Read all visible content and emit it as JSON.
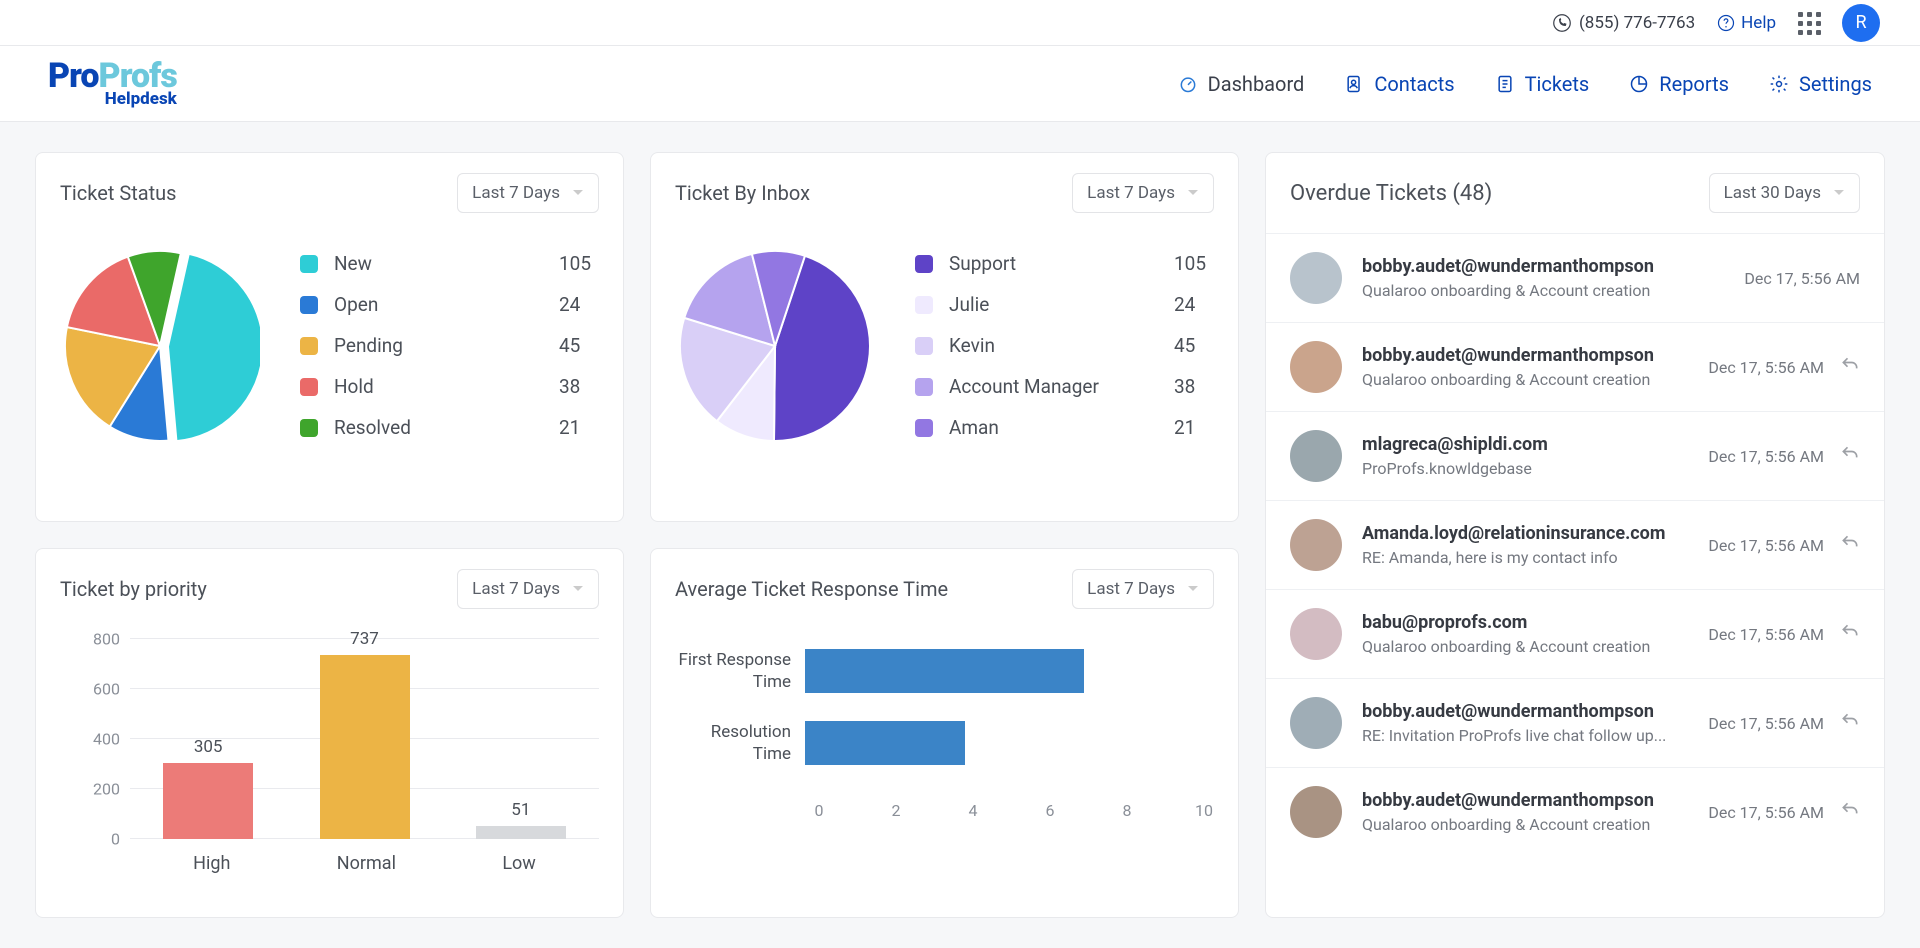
{
  "topbar": {
    "phone": "(855) 776-7763",
    "help": "Help",
    "avatar_letter": "R"
  },
  "brand": {
    "pro": "Pro",
    "profs": "Profs",
    "sub": "Helpdesk"
  },
  "nav": [
    {
      "label": "Dashbaord",
      "active": true
    },
    {
      "label": "Contacts",
      "active": false
    },
    {
      "label": "Tickets",
      "active": false
    },
    {
      "label": "Reports",
      "active": false
    },
    {
      "label": "Settings",
      "active": false
    }
  ],
  "cards": {
    "status": {
      "title": "Ticket Status",
      "range": "Last 7 Days"
    },
    "inbox": {
      "title": "Ticket By Inbox",
      "range": "Last 7 Days"
    },
    "priority": {
      "title": "Ticket by priority",
      "range": "Last 7 Days"
    },
    "response": {
      "title": "Average Ticket Response Time",
      "range": "Last 7 Days"
    }
  },
  "overdue": {
    "title": "Overdue Tickets (48)",
    "range": "Last 30 Days"
  },
  "tickets": [
    {
      "from": "bobby.audet@wundermanthompson",
      "subject": "Qualaroo onboarding & Account creation",
      "time": "Dec 17, 5:56 AM",
      "reply": false
    },
    {
      "from": "bobby.audet@wundermanthompson",
      "subject": "Qualaroo onboarding & Account creation",
      "time": "Dec 17, 5:56 AM",
      "reply": true
    },
    {
      "from": "mlagreca@shipldi.com",
      "subject": "ProProfs.knowldgebase",
      "time": "Dec 17, 5:56 AM",
      "reply": true
    },
    {
      "from": "Amanda.loyd@relationinsurance.com",
      "subject": "RE: Amanda, here is my contact info",
      "time": "Dec 17, 5:56 AM",
      "reply": true
    },
    {
      "from": "babu@proprofs.com",
      "subject": "Qualaroo onboarding & Account creation",
      "time": "Dec 17, 5:56 AM",
      "reply": true
    },
    {
      "from": "bobby.audet@wundermanthompson",
      "subject": "RE: Invitation ProProfs live chat follow up...",
      "time": "Dec 17, 5:56 AM",
      "reply": true
    },
    {
      "from": "bobby.audet@wundermanthompson",
      "subject": "Qualaroo onboarding & Account creation",
      "time": "Dec 17, 5:56 AM",
      "reply": true
    }
  ],
  "chart_data": [
    {
      "id": "status",
      "type": "pie",
      "title": "Ticket Status",
      "series": [
        {
          "name": "New",
          "value": 105,
          "color": "#2ecdd6"
        },
        {
          "name": "Open",
          "value": 24,
          "color": "#2a7ad6"
        },
        {
          "name": "Pending",
          "value": 45,
          "color": "#ecb445"
        },
        {
          "name": "Hold",
          "value": 38,
          "color": "#ea6a68"
        },
        {
          "name": "Resolved",
          "value": 21,
          "color": "#3fa52c"
        }
      ]
    },
    {
      "id": "inbox",
      "type": "pie",
      "title": "Ticket By Inbox",
      "series": [
        {
          "name": "Support",
          "value": 105,
          "color": "#5e43c7"
        },
        {
          "name": "Julie",
          "value": 24,
          "color": "#efeafe"
        },
        {
          "name": "Kevin",
          "value": 45,
          "color": "#d9cff7"
        },
        {
          "name": "Account Manager",
          "value": 38,
          "color": "#b5a3ee"
        },
        {
          "name": "Aman",
          "value": 21,
          "color": "#9277e2"
        }
      ]
    },
    {
      "id": "priority",
      "type": "bar",
      "title": "Ticket by priority",
      "categories": [
        "High",
        "Normal",
        "Low"
      ],
      "values": [
        305,
        737,
        51
      ],
      "colors": [
        "#ec7b78",
        "#ecb445",
        "#d7d9dc"
      ],
      "yticks": [
        0,
        200,
        400,
        600,
        800
      ],
      "ylim": [
        0,
        800
      ]
    },
    {
      "id": "response",
      "type": "hbar",
      "title": "Average Ticket Response Time",
      "categories": [
        "First Response Time",
        "Resolution Time"
      ],
      "values": [
        7,
        4
      ],
      "xticks": [
        0,
        2,
        4,
        6,
        8,
        10
      ],
      "xlim": [
        0,
        10
      ],
      "color": "#3b84c7"
    }
  ]
}
